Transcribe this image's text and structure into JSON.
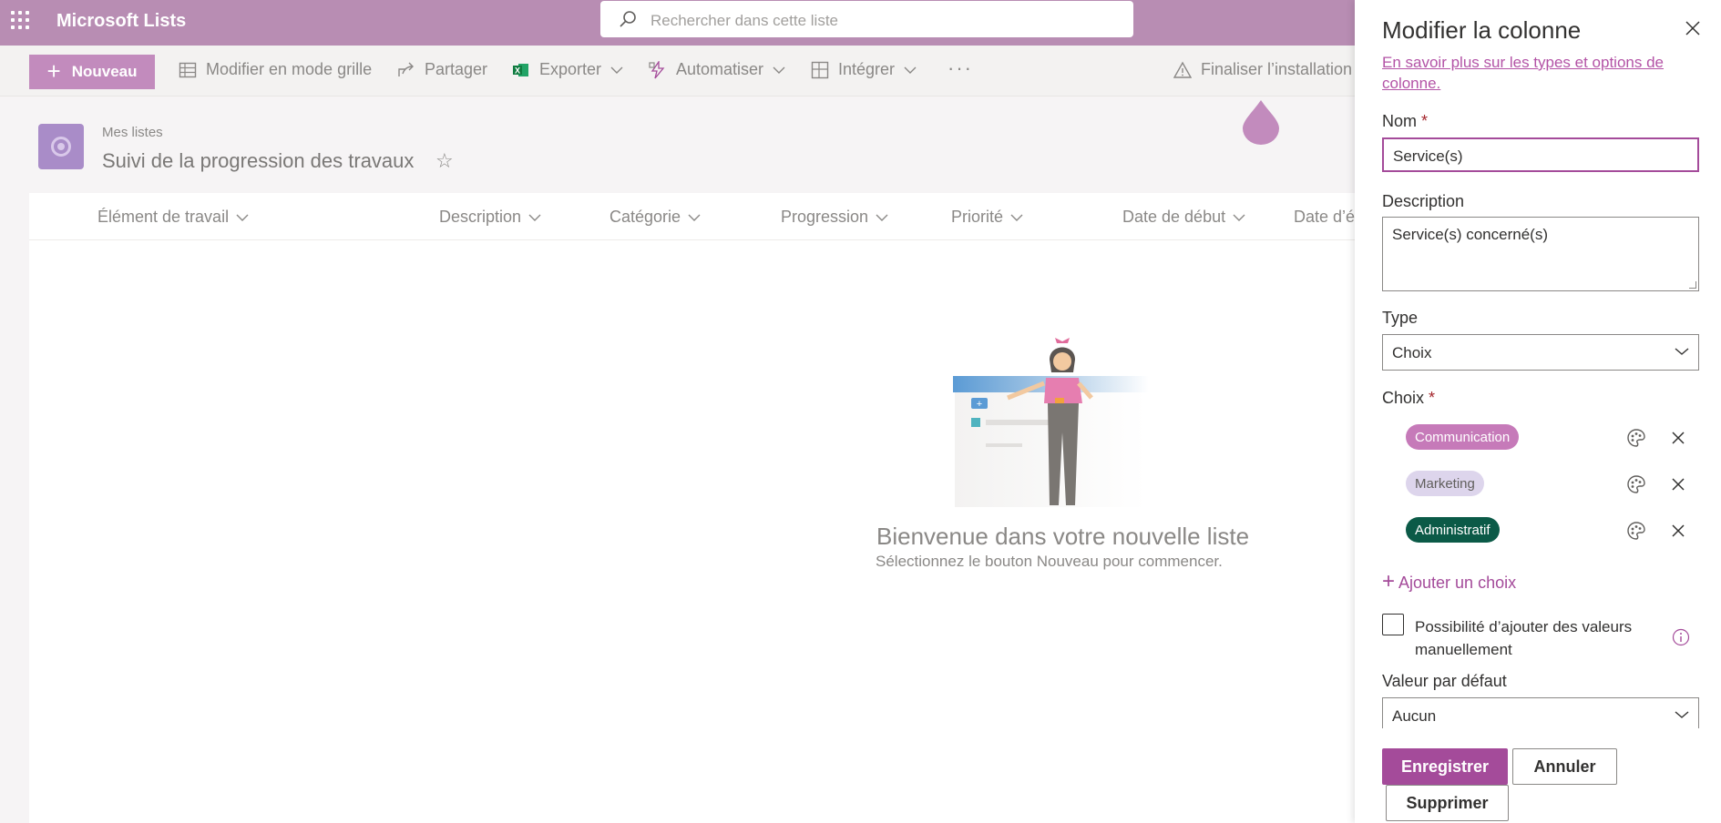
{
  "suite": {
    "app_name": "Microsoft Lists",
    "search_placeholder": "Rechercher dans cette liste"
  },
  "toolbar": {
    "new_label": "Nouveau",
    "grid_edit_label": "Modifier en mode grille",
    "share_label": "Partager",
    "export_label": "Exporter",
    "automate_label": "Automatiser",
    "integrate_label": "Intégrer",
    "more_label": "···",
    "finalize_label": "Finaliser l’installation"
  },
  "list": {
    "breadcrumb": "Mes listes",
    "title": "Suivi de la progression des travaux",
    "favorite_glyph": "☆"
  },
  "columns": [
    "Élément de travail",
    "Description",
    "Catégorie",
    "Progression",
    "Priorité",
    "Date de début",
    "Date d’é"
  ],
  "empty_state": {
    "title": "Bienvenue dans votre nouvelle liste",
    "subtitle": "Sélectionnez le bouton Nouveau pour commencer."
  },
  "panel": {
    "title": "Modifier la colonne",
    "learn_more_link": "En savoir plus sur les types et options de colonne.",
    "name_label": "Nom",
    "name_value": "Service(s)",
    "description_label": "Description",
    "description_value": "Service(s) concerné(s)",
    "type_label": "Type",
    "type_value": "Choix",
    "choices_label": "Choix",
    "required_mark": "*",
    "choices": [
      {
        "label": "Communication",
        "bg": "#c67ab9",
        "color": "#ffffff"
      },
      {
        "label": "Marketing",
        "bg": "#ddd5ec",
        "color": "#605e5c"
      },
      {
        "label": "Administratif",
        "bg": "#0b5a47",
        "color": "#ffffff"
      }
    ],
    "add_choice_label": "Ajouter un choix",
    "manual_values_label": "Possibilité d’ajouter des valeurs manuellement",
    "manual_values_checked": false,
    "default_label": "Valeur par défaut",
    "default_value": "Aucun",
    "save_label": "Enregistrer",
    "cancel_label": "Annuler",
    "delete_label": "Supprimer"
  },
  "colors": {
    "suite_bar": "#b88db3",
    "accent": "#a44b9a",
    "link": "#b353a6"
  }
}
